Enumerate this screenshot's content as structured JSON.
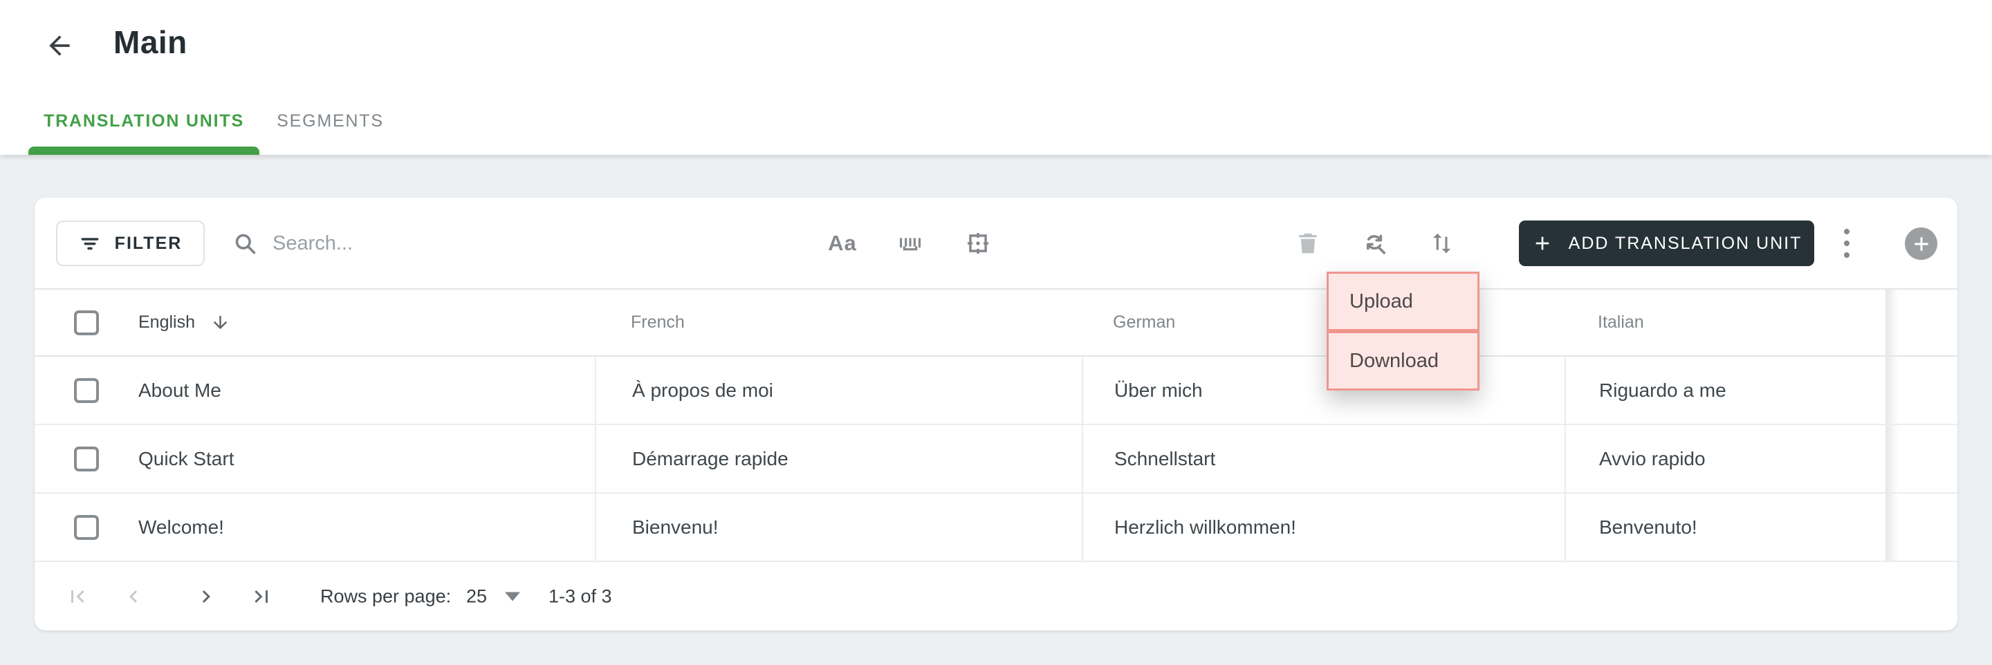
{
  "page": {
    "title": "Main"
  },
  "header": {
    "back_icon": "arrow-left-icon"
  },
  "tabs": [
    {
      "label": "TRANSLATION UNITS",
      "active": true
    },
    {
      "label": "SEGMENTS",
      "active": false
    }
  ],
  "toolbar": {
    "filter_label": "FILTER",
    "search_placeholder": "Search...",
    "case_toggle_glyph": "Aa",
    "icons": [
      "filter-icon",
      "search-icon",
      "match-case-icon",
      "barcode-icon",
      "select-frame-icon",
      "trash-icon",
      "refresh-search-icon",
      "sort-arrows-icon",
      "kebab-menu-icon",
      "plus-circle-icon"
    ],
    "add_button_label": "ADD TRANSLATION UNIT"
  },
  "context_menu": {
    "items": [
      {
        "label": "Upload"
      },
      {
        "label": "Download"
      }
    ],
    "highlight_fill": "#fce7e5",
    "highlight_border": "#f0958d"
  },
  "table": {
    "headers": {
      "english": "English",
      "french": "French",
      "german": "German",
      "italian": "Italian"
    },
    "sorted_column": "english",
    "sort_direction": "descending",
    "rows": [
      {
        "english": "About Me",
        "french": "À propos de moi",
        "german": "Über mich",
        "italian": "Riguardo a me"
      },
      {
        "english": "Quick Start",
        "french": "Démarrage rapide",
        "german": "Schnellstart",
        "italian": "Avvio rapido"
      },
      {
        "english": "Welcome!",
        "french": "Bienvenu!",
        "german": "Herzlich willkommen!",
        "italian": "Benvenuto!"
      }
    ]
  },
  "pagination": {
    "rows_per_page_label": "Rows per page:",
    "rows_per_page_value": "25",
    "range_label": "1-3 of 3",
    "first_disabled": true,
    "prev_disabled": true,
    "next_disabled": false,
    "last_disabled": false
  },
  "colors": {
    "accent_green": "#43a047",
    "dark_button": "#263238",
    "page_background": "#edf0f2",
    "menu_highlight": "#fce7e5",
    "menu_border": "#f0958d"
  }
}
